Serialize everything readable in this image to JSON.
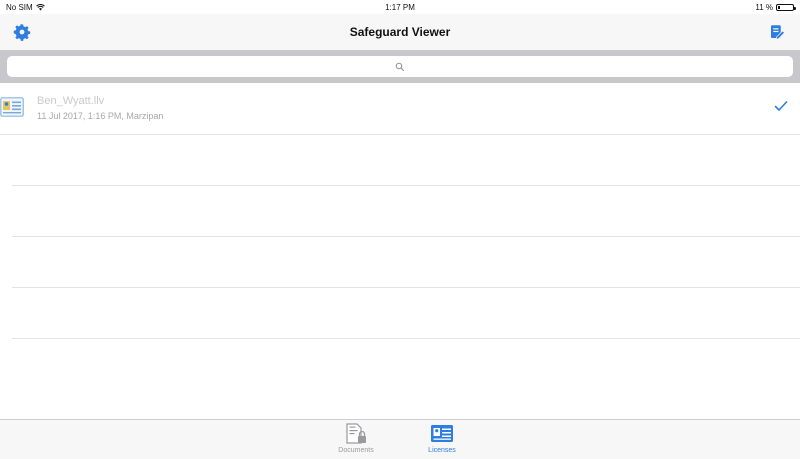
{
  "status_bar": {
    "carrier": "No SIM",
    "time": "1:17 PM",
    "battery_text": "11 %",
    "battery_level": 0.11
  },
  "nav": {
    "title": "Safeguard Viewer",
    "left_icon": "gear-icon",
    "right_icon": "compose-license-icon"
  },
  "search": {
    "placeholder": "",
    "value": ""
  },
  "licenses": [
    {
      "name": "Ben_Wyatt.llv",
      "meta": "11 Jul 2017, 1:16 PM, Marzipan",
      "selected": true,
      "icon": "license-card-icon"
    }
  ],
  "tabs": [
    {
      "label": "Documents",
      "icon": "document-lock-icon",
      "active": false
    },
    {
      "label": "Licenses",
      "icon": "license-card-icon",
      "active": true
    }
  ],
  "colors": {
    "accent": "#2e7de0",
    "inactive_tab": "#9a9a9e",
    "navbar_bg": "#f7f7f7",
    "search_bar_bg": "#c8c8cc"
  }
}
